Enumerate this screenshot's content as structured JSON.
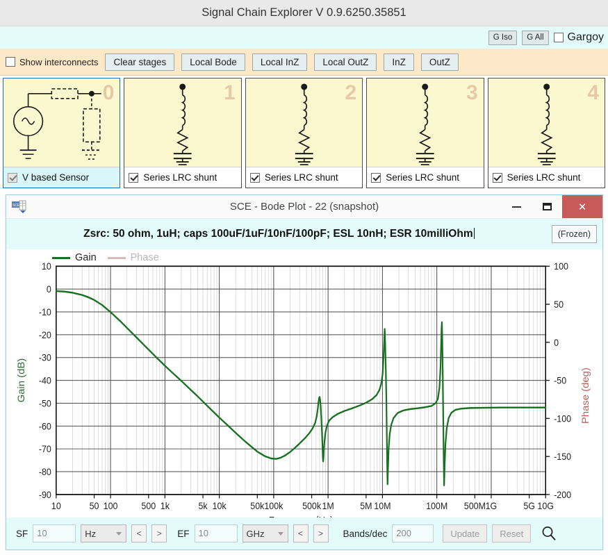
{
  "app": {
    "title": "Signal Chain Explorer V 0.9.6250.35851"
  },
  "top_toolbar": {
    "g_iso_label": "G Iso",
    "g_all_label": "G All",
    "gargoyle_label": "Gargoy",
    "gargoyle_checked": false
  },
  "stage_toolbar": {
    "show_interconnects_label": "Show interconnects",
    "show_interconnects_checked": false,
    "buttons": [
      {
        "label": "Clear stages",
        "name": "clear-stages-button"
      },
      {
        "label": "Local Bode",
        "name": "local-bode-button"
      },
      {
        "label": "Local InZ",
        "name": "local-inz-button"
      },
      {
        "label": "Local OutZ",
        "name": "local-outz-button"
      },
      {
        "label": "InZ",
        "name": "inz-button"
      },
      {
        "label": "OutZ",
        "name": "outz-button"
      }
    ]
  },
  "stages": [
    {
      "index": "0",
      "label": "V based Sensor",
      "checked": true,
      "selected": true,
      "icon": "v-based-sensor-icon"
    },
    {
      "index": "1",
      "label": "Series LRC shunt",
      "checked": true,
      "selected": false,
      "icon": "series-lrc-shunt-icon"
    },
    {
      "index": "2",
      "label": "Series LRC shunt",
      "checked": true,
      "selected": false,
      "icon": "series-lrc-shunt-icon"
    },
    {
      "index": "3",
      "label": "Series LRC shunt",
      "checked": true,
      "selected": false,
      "icon": "series-lrc-shunt-icon"
    },
    {
      "index": "4",
      "label": "Series LRC shunt",
      "checked": true,
      "selected": false,
      "icon": "series-lrc-shunt-icon"
    }
  ],
  "bode_window": {
    "title": "SCE - Bode Plot - 22  (snapshot)",
    "icon": "sce-app-icon",
    "minimize_icon": "minimize-icon",
    "maximize_icon": "maximize-icon",
    "close_icon": "close-icon",
    "caption": "Zsrc: 50 ohm, 1uH; caps 100uF/1uF/10nF/100pF; ESL 10nH; ESR 10milliOhm",
    "frozen_label": "(Frozen)"
  },
  "bottom_bar": {
    "sf_label": "SF",
    "sf_value": "10",
    "sf_unit": "Hz",
    "sf_dec_label": "<",
    "sf_inc_label": ">",
    "ef_label": "EF",
    "ef_value": "10",
    "ef_unit": "GHz",
    "ef_dec_label": "<",
    "ef_inc_label": ">",
    "bands_label": "Bands/dec",
    "bands_value": "200",
    "update_label": "Update",
    "reset_label": "Reset",
    "search_icon": "search-icon"
  },
  "chart_data": {
    "type": "line",
    "title": "",
    "xlabel": "Frequency (Hz)",
    "ylabel": "Gain (dB)",
    "y2label": "Phase (deg)",
    "xscale": "log",
    "xlim": [
      10,
      10000000000
    ],
    "ylim": [
      -90,
      10
    ],
    "y2lim": [
      -200,
      100
    ],
    "grid": true,
    "legend_position": "top-left",
    "xticks": [
      {
        "v": 10,
        "label": "10"
      },
      {
        "v": 50,
        "label": "50"
      },
      {
        "v": 100,
        "label": "100"
      },
      {
        "v": 500,
        "label": "500"
      },
      {
        "v": 1000,
        "label": "1k"
      },
      {
        "v": 5000,
        "label": "5k"
      },
      {
        "v": 10000,
        "label": "10k"
      },
      {
        "v": 50000,
        "label": "50k"
      },
      {
        "v": 100000,
        "label": "100k"
      },
      {
        "v": 500000,
        "label": "500k"
      },
      {
        "v": 1000000,
        "label": "1M"
      },
      {
        "v": 5000000,
        "label": "5M"
      },
      {
        "v": 10000000,
        "label": "10M"
      },
      {
        "v": 100000000,
        "label": "100M"
      },
      {
        "v": 500000000,
        "label": "500M"
      },
      {
        "v": 1000000000,
        "label": "1G"
      },
      {
        "v": 5000000000,
        "label": "5G"
      },
      {
        "v": 10000000000,
        "label": "10G"
      }
    ],
    "yticks": [
      10,
      0,
      -10,
      -20,
      -30,
      -40,
      -50,
      -60,
      -70,
      -80,
      -90
    ],
    "y2ticks": [
      100,
      50,
      0,
      -50,
      -100,
      -150,
      -200
    ],
    "series": [
      {
        "name": "Gain",
        "color": "#17701f",
        "axis": "left",
        "visible": true,
        "points": [
          [
            10,
            -0.9
          ],
          [
            14,
            -1.1
          ],
          [
            20,
            -1.6
          ],
          [
            30,
            -2.6
          ],
          [
            40,
            -3.7
          ],
          [
            50,
            -4.8
          ],
          [
            70,
            -7.0
          ],
          [
            100,
            -10.1
          ],
          [
            150,
            -14.0
          ],
          [
            200,
            -17.0
          ],
          [
            300,
            -21.2
          ],
          [
            400,
            -24.2
          ],
          [
            500,
            -26.5
          ],
          [
            700,
            -30.0
          ],
          [
            1000,
            -33.6
          ],
          [
            1500,
            -37.5
          ],
          [
            2000,
            -40.2
          ],
          [
            3000,
            -44.2
          ],
          [
            4000,
            -47.0
          ],
          [
            5000,
            -49.3
          ],
          [
            7000,
            -52.7
          ],
          [
            10000,
            -56.3
          ],
          [
            15000,
            -60.2
          ],
          [
            20000,
            -63.0
          ],
          [
            30000,
            -66.8
          ],
          [
            40000,
            -69.3
          ],
          [
            50000,
            -71.2
          ],
          [
            70000,
            -73.3
          ],
          [
            90000,
            -74.2
          ],
          [
            110000,
            -74.4
          ],
          [
            130000,
            -74.0
          ],
          [
            160000,
            -73.0
          ],
          [
            200000,
            -71.4
          ],
          [
            250000,
            -69.4
          ],
          [
            300000,
            -67.6
          ],
          [
            380000,
            -65.2
          ],
          [
            450000,
            -63.2
          ],
          [
            520000,
            -61.0
          ],
          [
            580000,
            -58.6
          ],
          [
            620000,
            -55.6
          ],
          [
            650000,
            -52.0
          ],
          [
            670000,
            -49.2
          ],
          [
            685000,
            -47.6
          ],
          [
            700000,
            -47.3
          ],
          [
            715000,
            -48.4
          ],
          [
            730000,
            -51.0
          ],
          [
            750000,
            -56.0
          ],
          [
            770000,
            -62.0
          ],
          [
            790000,
            -69.0
          ],
          [
            800000,
            -73.5
          ],
          [
            810000,
            -75.5
          ],
          [
            820000,
            -74.6
          ],
          [
            835000,
            -71.0
          ],
          [
            860000,
            -66.5
          ],
          [
            900000,
            -62.5
          ],
          [
            960000,
            -59.6
          ],
          [
            1050000,
            -57.6
          ],
          [
            1200000,
            -56.2
          ],
          [
            1500000,
            -54.7
          ],
          [
            2000000,
            -53.4
          ],
          [
            2800000,
            -52.2
          ],
          [
            3800000,
            -51.0
          ],
          [
            5000000,
            -49.8
          ],
          [
            6500000,
            -48.2
          ],
          [
            7800000,
            -46.4
          ],
          [
            8800000,
            -44.2
          ],
          [
            9500000,
            -41.5
          ],
          [
            10100000,
            -37.0
          ],
          [
            10500000,
            -29.0
          ],
          [
            10800000,
            -22.0
          ],
          [
            11000000,
            -17.5
          ],
          [
            11200000,
            -23.0
          ],
          [
            11500000,
            -34.0
          ],
          [
            11800000,
            -48.0
          ],
          [
            12000000,
            -62.0
          ],
          [
            12200000,
            -76.0
          ],
          [
            12400000,
            -85.5
          ],
          [
            12600000,
            -80.0
          ],
          [
            13000000,
            -70.0
          ],
          [
            13600000,
            -63.5
          ],
          [
            14500000,
            -59.5
          ],
          [
            16000000,
            -56.5
          ],
          [
            19000000,
            -54.3
          ],
          [
            24000000,
            -53.2
          ],
          [
            32000000,
            -52.6
          ],
          [
            45000000,
            -52.2
          ],
          [
            60000000,
            -51.8
          ],
          [
            80000000,
            -51.2
          ],
          [
            95000000,
            -50.0
          ],
          [
            105000000,
            -48.0
          ],
          [
            112000000,
            -43.0
          ],
          [
            117000000,
            -34.0
          ],
          [
            120000000,
            -24.0
          ],
          [
            122000000,
            -17.5
          ],
          [
            124000000,
            -14.5
          ],
          [
            126000000,
            -22.0
          ],
          [
            128000000,
            -34.0
          ],
          [
            130000000,
            -48.0
          ],
          [
            132000000,
            -62.0
          ],
          [
            134000000,
            -76.0
          ],
          [
            136000000,
            -86.0
          ],
          [
            139000000,
            -78.0
          ],
          [
            144000000,
            -68.0
          ],
          [
            152000000,
            -61.0
          ],
          [
            165000000,
            -56.5
          ],
          [
            185000000,
            -54.2
          ],
          [
            220000000,
            -52.9
          ],
          [
            280000000,
            -52.4
          ],
          [
            400000000,
            -52.1
          ],
          [
            700000000,
            -52.0
          ],
          [
            1500000000,
            -51.9
          ],
          [
            4000000000,
            -51.9
          ],
          [
            10000000000,
            -51.9
          ]
        ]
      },
      {
        "name": "Phase",
        "color": "#d9b8bc",
        "axis": "right",
        "visible": false,
        "points": []
      }
    ]
  }
}
